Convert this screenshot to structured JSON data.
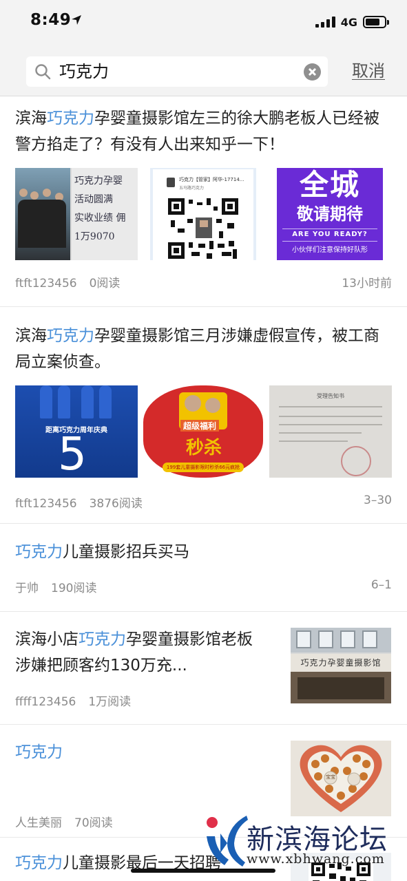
{
  "status_bar": {
    "time": "8:49",
    "network": "4G"
  },
  "search": {
    "query": "巧克力",
    "cancel_label": "取消"
  },
  "results": [
    {
      "title_pre": "滨海",
      "title_hl": "巧克力",
      "title_post": "孕婴童摄影馆左三的徐大鹏老板人已经被警方掐走了？有没有人出来知乎一下！",
      "author": "ftft123456",
      "reads": "0阅读",
      "time": "13小时前",
      "images": [
        {
          "alt_text": "巧克力孕婴\n活动圆满\n实收业绩 佣\n1万9070"
        },
        {
          "header": "巧克力【管家】阿华-17714...",
          "sub": "五马路巧克力"
        },
        {
          "big": "全城",
          "line2": "敬请期待",
          "line3": "ARE YOU READY?",
          "line4": "小伙伴们注意保持好队形"
        }
      ]
    },
    {
      "title_pre": "滨海",
      "title_hl": "巧克力",
      "title_post": "孕婴童摄影馆三月涉嫌虚假宣传，被工商局立案侦查。",
      "author": "ftft123456",
      "reads": "3876阅读",
      "time": "3–30",
      "images": [
        {
          "caption": "距离巧克力周年庆典",
          "number": "5"
        },
        {
          "banner": "超级福利",
          "big": "秒杀",
          "price": "199套儿童摄影限时秒杀66元疯抢"
        },
        {
          "header": "受理告知书"
        }
      ]
    },
    {
      "title_pre": "",
      "title_hl": "巧克力",
      "title_post": "儿童摄影招兵买马",
      "author": "于帅",
      "reads": "190阅读",
      "time": "6–1"
    },
    {
      "title_pre": "滨海小店",
      "title_hl": "巧克力",
      "title_post": "孕婴童摄影馆老板涉嫌把顾客约130万充...",
      "author": "ffff123456",
      "reads": "1万阅读",
      "sign": "巧克力孕婴童摄影馆"
    },
    {
      "title_pre": "",
      "title_hl": "巧克力",
      "title_post": "",
      "author": "人生美丽",
      "reads": "70阅读",
      "label": "宝宝"
    },
    {
      "title_pre": "",
      "title_hl": "巧克力",
      "title_post": "儿童摄影最后一天招聘"
    }
  ],
  "watermark": {
    "name": "新滨海论坛",
    "url": "www.xbhwang.com"
  },
  "colors": {
    "highlight": "#4a90d9",
    "meta": "#8a8a8a",
    "header_bg": "#f3f3f3"
  }
}
